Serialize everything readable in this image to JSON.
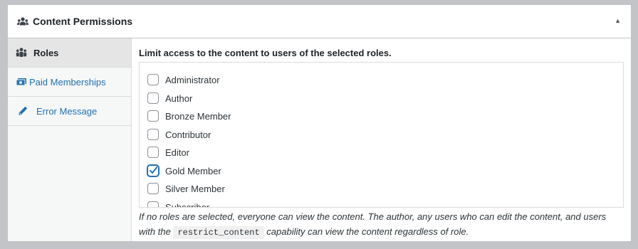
{
  "metabox": {
    "title": "Content Permissions",
    "header_icon": "users-group-icon",
    "toggle_icon": "triangle-up-icon"
  },
  "tabs": [
    {
      "label": "Roles",
      "icon": "groups-icon",
      "active": true
    },
    {
      "label": "Paid Memberships",
      "icon": "money-icon",
      "active": false
    },
    {
      "label": "Error Message",
      "icon": "edit-pencil-icon",
      "active": false
    }
  ],
  "roles_panel": {
    "intro": "Limit access to the content to users of the selected roles.",
    "roles": [
      {
        "label": "Administrator",
        "checked": false
      },
      {
        "label": "Author",
        "checked": false
      },
      {
        "label": "Bronze Member",
        "checked": false
      },
      {
        "label": "Contributor",
        "checked": false
      },
      {
        "label": "Editor",
        "checked": false
      },
      {
        "label": "Gold Member",
        "checked": true
      },
      {
        "label": "Silver Member",
        "checked": false
      },
      {
        "label": "Subscriber",
        "checked": false
      }
    ],
    "help_part1": "If no roles are selected, everyone can view the content. The author, any users who can edit the content, and users with the",
    "help_code": "restrict_content",
    "help_part2": "capability can view the content regardless of role."
  },
  "colors": {
    "accent": "#2271b1",
    "border": "#c3c4c7",
    "page_bg": "#c3c4c7"
  }
}
